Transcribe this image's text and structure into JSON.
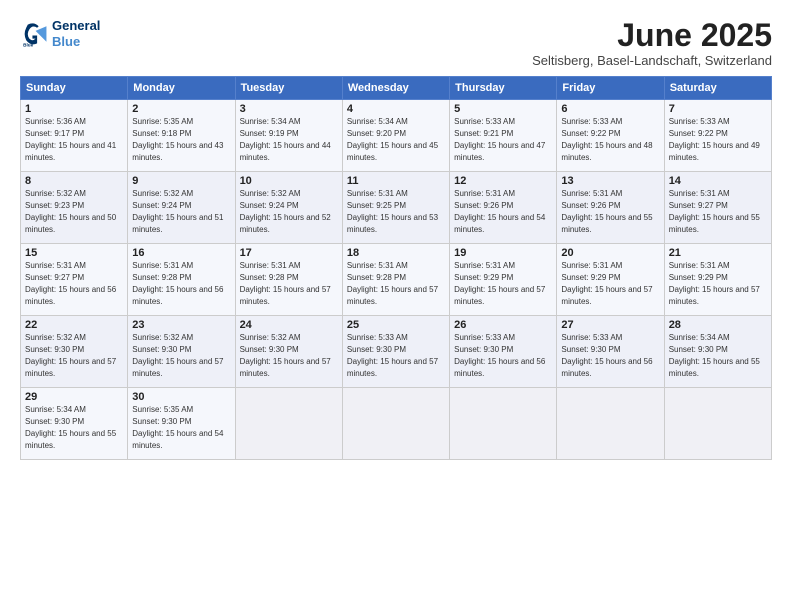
{
  "logo": {
    "line1": "General",
    "line2": "Blue"
  },
  "title": "June 2025",
  "subtitle": "Seltisberg, Basel-Landschaft, Switzerland",
  "days_of_week": [
    "Sunday",
    "Monday",
    "Tuesday",
    "Wednesday",
    "Thursday",
    "Friday",
    "Saturday"
  ],
  "weeks": [
    [
      {
        "day": "1",
        "sunrise": "Sunrise: 5:36 AM",
        "sunset": "Sunset: 9:17 PM",
        "daylight": "Daylight: 15 hours and 41 minutes."
      },
      {
        "day": "2",
        "sunrise": "Sunrise: 5:35 AM",
        "sunset": "Sunset: 9:18 PM",
        "daylight": "Daylight: 15 hours and 43 minutes."
      },
      {
        "day": "3",
        "sunrise": "Sunrise: 5:34 AM",
        "sunset": "Sunset: 9:19 PM",
        "daylight": "Daylight: 15 hours and 44 minutes."
      },
      {
        "day": "4",
        "sunrise": "Sunrise: 5:34 AM",
        "sunset": "Sunset: 9:20 PM",
        "daylight": "Daylight: 15 hours and 45 minutes."
      },
      {
        "day": "5",
        "sunrise": "Sunrise: 5:33 AM",
        "sunset": "Sunset: 9:21 PM",
        "daylight": "Daylight: 15 hours and 47 minutes."
      },
      {
        "day": "6",
        "sunrise": "Sunrise: 5:33 AM",
        "sunset": "Sunset: 9:22 PM",
        "daylight": "Daylight: 15 hours and 48 minutes."
      },
      {
        "day": "7",
        "sunrise": "Sunrise: 5:33 AM",
        "sunset": "Sunset: 9:22 PM",
        "daylight": "Daylight: 15 hours and 49 minutes."
      }
    ],
    [
      {
        "day": "8",
        "sunrise": "Sunrise: 5:32 AM",
        "sunset": "Sunset: 9:23 PM",
        "daylight": "Daylight: 15 hours and 50 minutes."
      },
      {
        "day": "9",
        "sunrise": "Sunrise: 5:32 AM",
        "sunset": "Sunset: 9:24 PM",
        "daylight": "Daylight: 15 hours and 51 minutes."
      },
      {
        "day": "10",
        "sunrise": "Sunrise: 5:32 AM",
        "sunset": "Sunset: 9:24 PM",
        "daylight": "Daylight: 15 hours and 52 minutes."
      },
      {
        "day": "11",
        "sunrise": "Sunrise: 5:31 AM",
        "sunset": "Sunset: 9:25 PM",
        "daylight": "Daylight: 15 hours and 53 minutes."
      },
      {
        "day": "12",
        "sunrise": "Sunrise: 5:31 AM",
        "sunset": "Sunset: 9:26 PM",
        "daylight": "Daylight: 15 hours and 54 minutes."
      },
      {
        "day": "13",
        "sunrise": "Sunrise: 5:31 AM",
        "sunset": "Sunset: 9:26 PM",
        "daylight": "Daylight: 15 hours and 55 minutes."
      },
      {
        "day": "14",
        "sunrise": "Sunrise: 5:31 AM",
        "sunset": "Sunset: 9:27 PM",
        "daylight": "Daylight: 15 hours and 55 minutes."
      }
    ],
    [
      {
        "day": "15",
        "sunrise": "Sunrise: 5:31 AM",
        "sunset": "Sunset: 9:27 PM",
        "daylight": "Daylight: 15 hours and 56 minutes."
      },
      {
        "day": "16",
        "sunrise": "Sunrise: 5:31 AM",
        "sunset": "Sunset: 9:28 PM",
        "daylight": "Daylight: 15 hours and 56 minutes."
      },
      {
        "day": "17",
        "sunrise": "Sunrise: 5:31 AM",
        "sunset": "Sunset: 9:28 PM",
        "daylight": "Daylight: 15 hours and 57 minutes."
      },
      {
        "day": "18",
        "sunrise": "Sunrise: 5:31 AM",
        "sunset": "Sunset: 9:28 PM",
        "daylight": "Daylight: 15 hours and 57 minutes."
      },
      {
        "day": "19",
        "sunrise": "Sunrise: 5:31 AM",
        "sunset": "Sunset: 9:29 PM",
        "daylight": "Daylight: 15 hours and 57 minutes."
      },
      {
        "day": "20",
        "sunrise": "Sunrise: 5:31 AM",
        "sunset": "Sunset: 9:29 PM",
        "daylight": "Daylight: 15 hours and 57 minutes."
      },
      {
        "day": "21",
        "sunrise": "Sunrise: 5:31 AM",
        "sunset": "Sunset: 9:29 PM",
        "daylight": "Daylight: 15 hours and 57 minutes."
      }
    ],
    [
      {
        "day": "22",
        "sunrise": "Sunrise: 5:32 AM",
        "sunset": "Sunset: 9:30 PM",
        "daylight": "Daylight: 15 hours and 57 minutes."
      },
      {
        "day": "23",
        "sunrise": "Sunrise: 5:32 AM",
        "sunset": "Sunset: 9:30 PM",
        "daylight": "Daylight: 15 hours and 57 minutes."
      },
      {
        "day": "24",
        "sunrise": "Sunrise: 5:32 AM",
        "sunset": "Sunset: 9:30 PM",
        "daylight": "Daylight: 15 hours and 57 minutes."
      },
      {
        "day": "25",
        "sunrise": "Sunrise: 5:33 AM",
        "sunset": "Sunset: 9:30 PM",
        "daylight": "Daylight: 15 hours and 57 minutes."
      },
      {
        "day": "26",
        "sunrise": "Sunrise: 5:33 AM",
        "sunset": "Sunset: 9:30 PM",
        "daylight": "Daylight: 15 hours and 56 minutes."
      },
      {
        "day": "27",
        "sunrise": "Sunrise: 5:33 AM",
        "sunset": "Sunset: 9:30 PM",
        "daylight": "Daylight: 15 hours and 56 minutes."
      },
      {
        "day": "28",
        "sunrise": "Sunrise: 5:34 AM",
        "sunset": "Sunset: 9:30 PM",
        "daylight": "Daylight: 15 hours and 55 minutes."
      }
    ],
    [
      {
        "day": "29",
        "sunrise": "Sunrise: 5:34 AM",
        "sunset": "Sunset: 9:30 PM",
        "daylight": "Daylight: 15 hours and 55 minutes."
      },
      {
        "day": "30",
        "sunrise": "Sunrise: 5:35 AM",
        "sunset": "Sunset: 9:30 PM",
        "daylight": "Daylight: 15 hours and 54 minutes."
      },
      {
        "day": "",
        "sunrise": "",
        "sunset": "",
        "daylight": ""
      },
      {
        "day": "",
        "sunrise": "",
        "sunset": "",
        "daylight": ""
      },
      {
        "day": "",
        "sunrise": "",
        "sunset": "",
        "daylight": ""
      },
      {
        "day": "",
        "sunrise": "",
        "sunset": "",
        "daylight": ""
      },
      {
        "day": "",
        "sunrise": "",
        "sunset": "",
        "daylight": ""
      }
    ]
  ]
}
